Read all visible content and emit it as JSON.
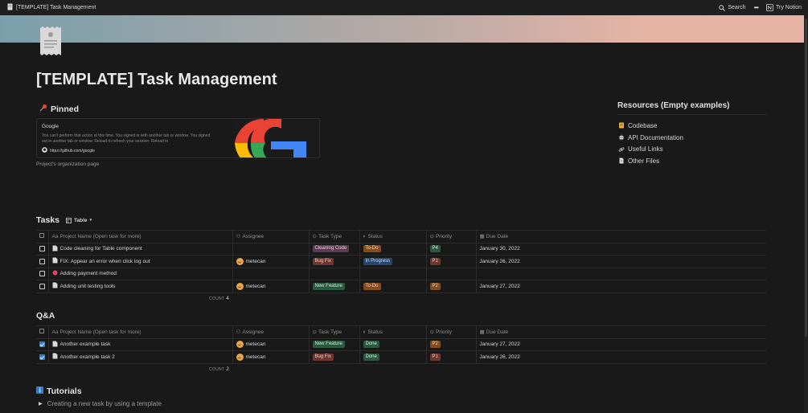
{
  "topbar": {
    "page_title": "[TEMPLATE] Task Management",
    "search_label": "Search",
    "more_label": "•••",
    "try_label": "Try Notion"
  },
  "page": {
    "title": "[TEMPLATE] Task Management"
  },
  "pinned": {
    "heading": "Pinned",
    "bookmark": {
      "title": "Google",
      "description": "You can't perform that action at this time. You signed in with another tab or window. You signed out in another tab or window. Reload to refresh your session. Reload to",
      "url": "https://github.com/google"
    },
    "caption": "Project's organization page"
  },
  "resources": {
    "heading": "Resources (Empty examples)",
    "items": [
      {
        "label": "Codebase",
        "icon": "notebook-icon"
      },
      {
        "label": "API Documentation",
        "icon": "robot-icon"
      },
      {
        "label": "Useful Links",
        "icon": "link-icon"
      },
      {
        "label": "Other Files",
        "icon": "document-icon"
      }
    ]
  },
  "columns": {
    "name": "Project Name (Open task for more)",
    "assignee": "Assignee",
    "task_type": "Task Type",
    "status": "Status",
    "priority": "Priority",
    "due_date": "Due Date"
  },
  "tasks": {
    "heading": "Tasks",
    "view": "Table",
    "rows": [
      {
        "name": "Code cleaning for Table component",
        "assignee": "",
        "task_type": "Cleaning Code",
        "status": "To-Do",
        "priority": "P4",
        "due_date": "January 30, 2022"
      },
      {
        "name": "FIX: Appear an error when click log out",
        "assignee": "metecan",
        "task_type": "Bug Fix",
        "status": "In Progress",
        "priority": "P1",
        "due_date": "January 26, 2022"
      },
      {
        "name": "Adding payment method",
        "assignee": "",
        "task_type": "",
        "status": "",
        "priority": "",
        "due_date": ""
      },
      {
        "name": "Adding unit testing tools",
        "assignee": "metecan",
        "task_type": "New Feature",
        "status": "To-Do",
        "priority": "P2",
        "due_date": "January 27, 2022"
      }
    ],
    "count_label": "COUNT",
    "count": "4"
  },
  "qa": {
    "heading": "Q&A",
    "rows": [
      {
        "name": "Another example task",
        "assignee": "metecan",
        "task_type": "New Feature",
        "status": "Done",
        "priority": "P2",
        "due_date": "January 27, 2022"
      },
      {
        "name": "Another example task 2",
        "assignee": "metecan",
        "task_type": "Bug Fix",
        "status": "Done",
        "priority": "P1",
        "due_date": "January 26, 2022"
      }
    ],
    "count_label": "COUNT",
    "count": "2"
  },
  "tutorials": {
    "heading": "Tutorials",
    "item": "Creating a new task by using a template"
  },
  "colors": {
    "background": "#191919",
    "cleaning_code_tag": "#5c3b52",
    "bug_fix_tag": "#6e3630",
    "new_feature_tag": "#2b593f",
    "todo_tag": "#854c1d",
    "in_progress_tag": "#28456c",
    "done_tag": "#2b593f",
    "p4_tag": "#2b593f",
    "p1_tag": "#6e3630",
    "p2_tag": "#854c1d",
    "checkbox_checked": "#2383e2"
  }
}
